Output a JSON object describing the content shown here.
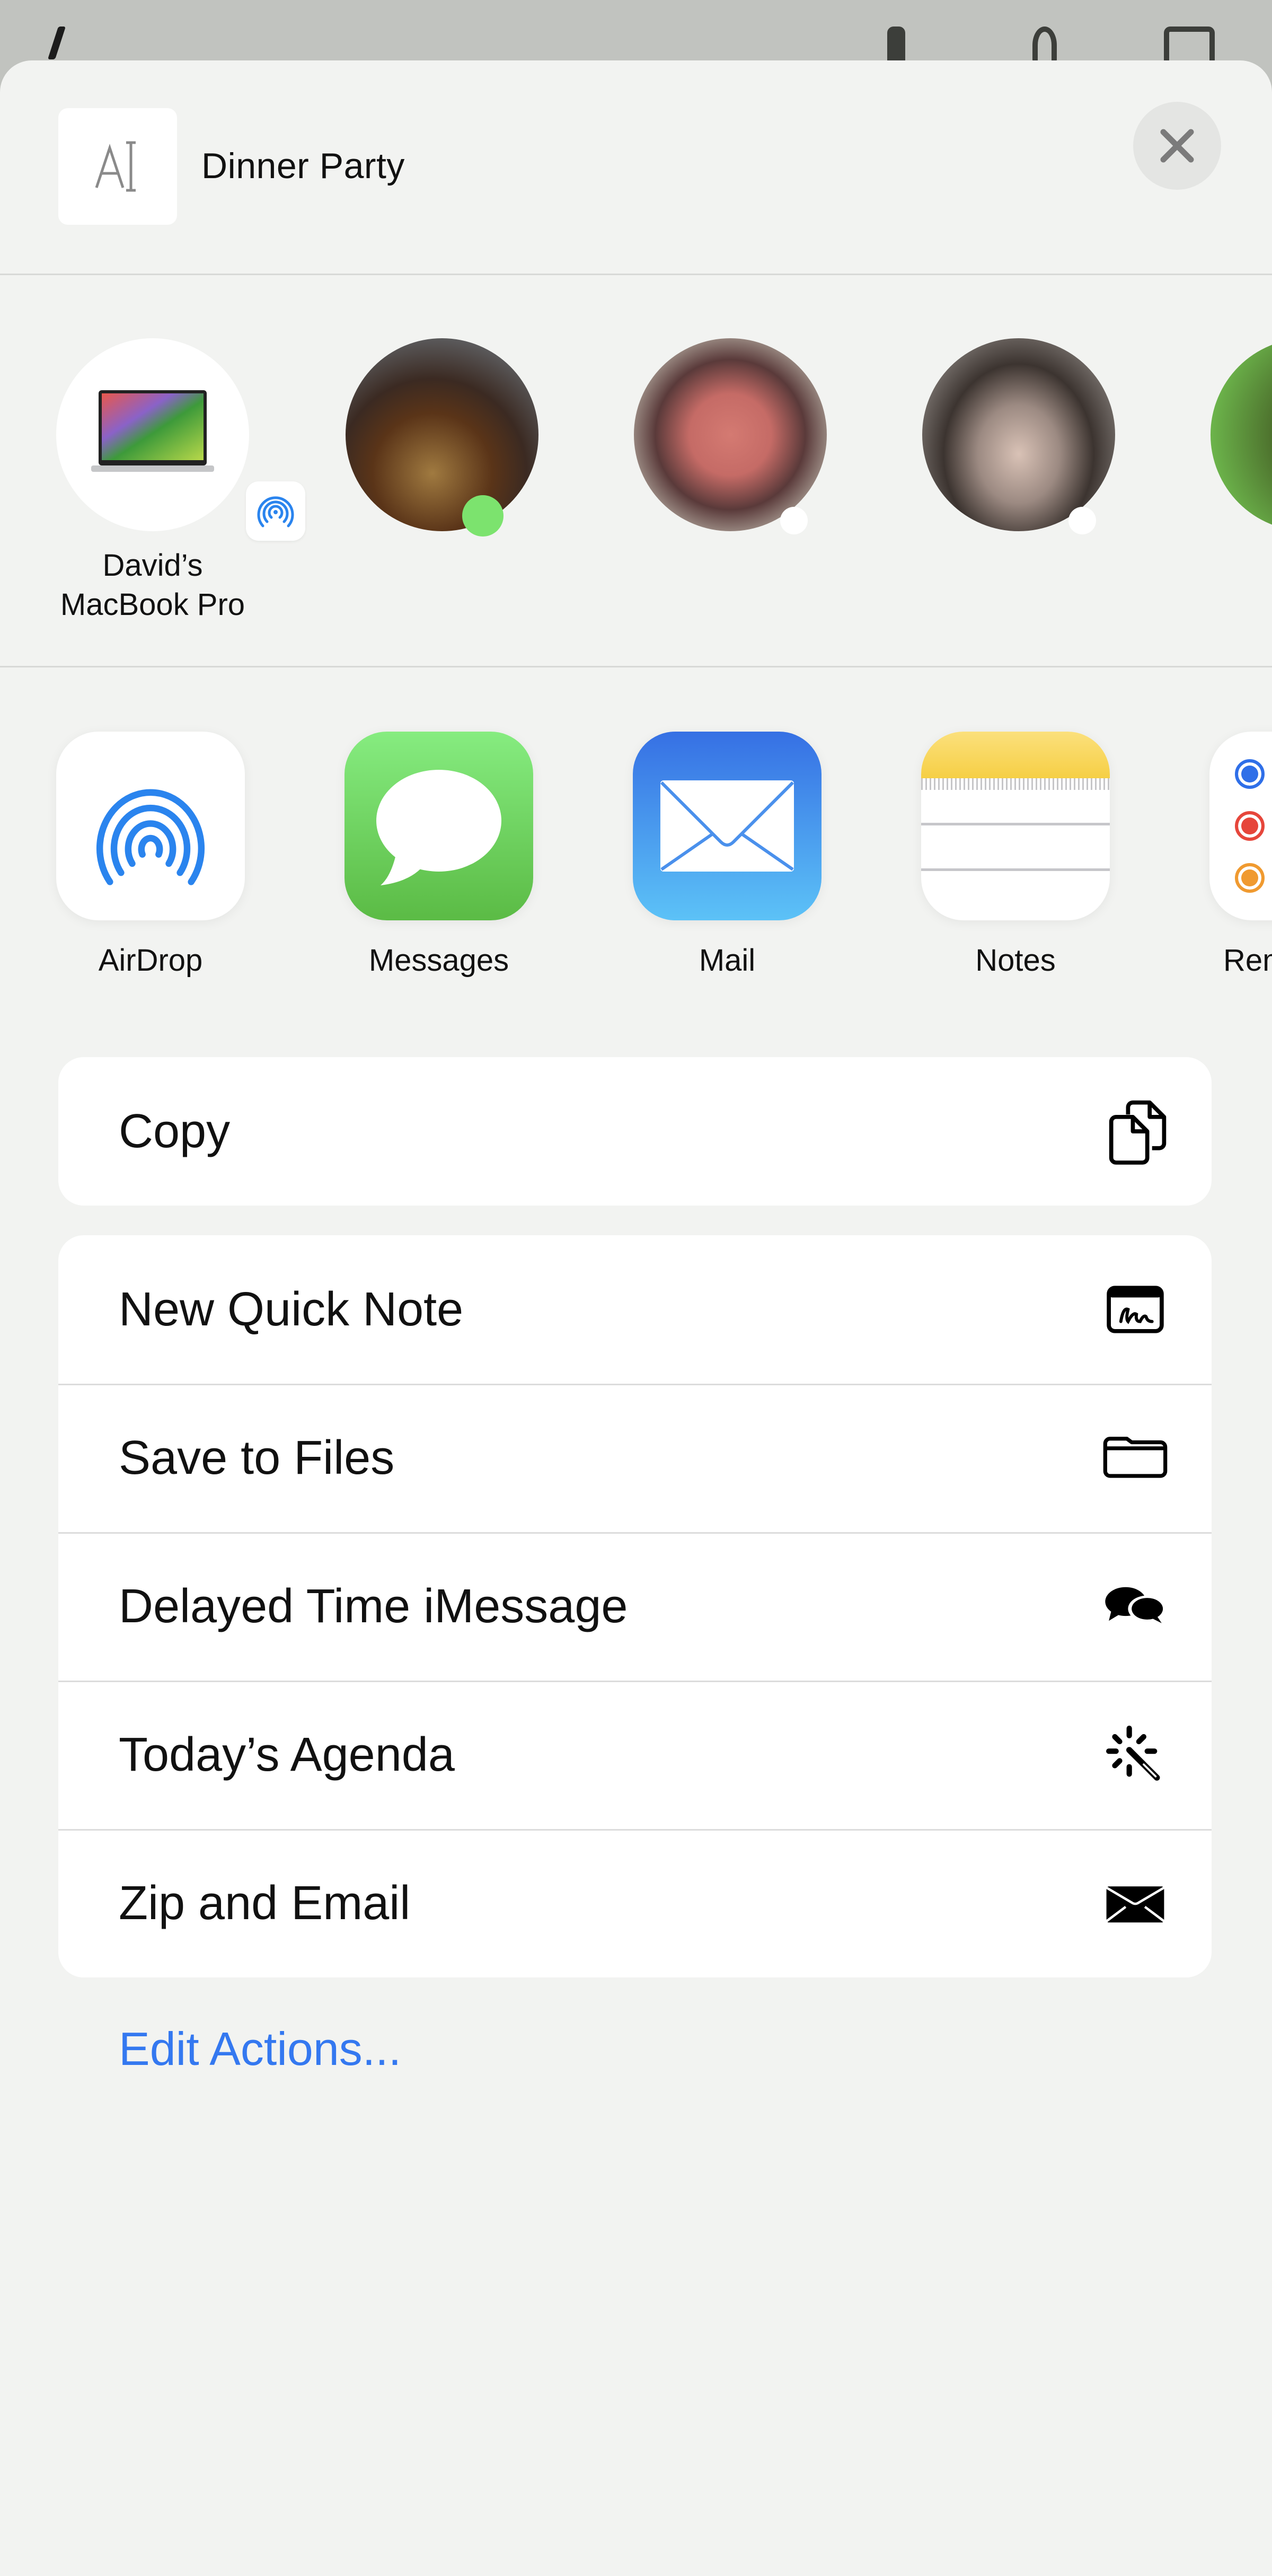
{
  "background_app": {
    "icons": [
      "back-chevron-icon",
      "flashlight-icon",
      "timer-icon",
      "calculator-icon"
    ]
  },
  "share_sheet": {
    "document": {
      "title": "Dinner Party",
      "thumbnail_icon": "text-format-icon"
    },
    "close_label": "Close",
    "people": [
      {
        "name": "David’s\nMacBook Pro",
        "line1": "David’s",
        "line2": "MacBook Pro",
        "type": "airdrop-device",
        "badge": "airdrop-icon"
      },
      {
        "name": "",
        "type": "contact",
        "badge": "messages"
      },
      {
        "name": "",
        "type": "contact",
        "badge": "online"
      },
      {
        "name": "",
        "type": "contact",
        "badge": "online"
      },
      {
        "name": "",
        "type": "contact",
        "badge": ""
      }
    ],
    "apps": [
      {
        "label": "AirDrop",
        "icon": "airdrop-icon"
      },
      {
        "label": "Messages",
        "icon": "messages-icon"
      },
      {
        "label": "Mail",
        "icon": "mail-icon"
      },
      {
        "label": "Notes",
        "icon": "notes-icon"
      },
      {
        "label": "Reminders",
        "icon": "reminders-icon"
      }
    ],
    "action_groups": [
      [
        {
          "label": "Copy",
          "icon": "copy-icon"
        }
      ],
      [
        {
          "label": "New Quick Note",
          "icon": "quick-note-icon"
        },
        {
          "label": "Save to Files",
          "icon": "folder-icon"
        },
        {
          "label": "Delayed Time iMessage",
          "icon": "chat-bubbles-icon"
        },
        {
          "label": "Today’s Agenda",
          "icon": "magic-wand-icon"
        },
        {
          "label": "Zip and Email",
          "icon": "envelope-icon"
        }
      ]
    ],
    "edit_actions_label": "Edit Actions..."
  },
  "colors": {
    "accent": "#3478F0",
    "sheet_background": "#F2F3F1",
    "messages_green": "#5BBB45",
    "mail_blue": "#3670E4",
    "notes_yellow": "#F6D44C"
  }
}
